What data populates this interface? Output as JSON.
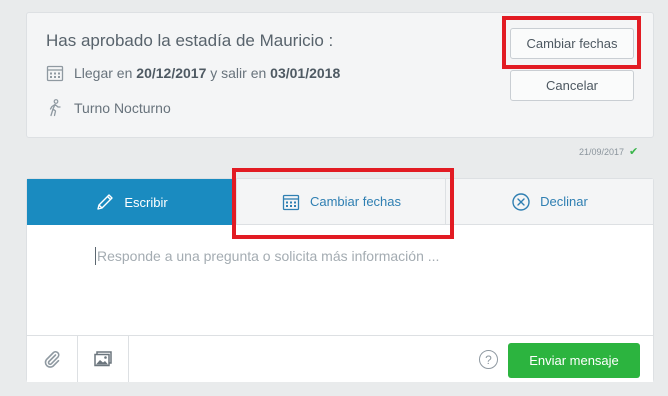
{
  "approval": {
    "title": "Has aprobado la estadía de Mauricio :",
    "arrive_label": "Llegar en",
    "arrive_date": "20/12/2017",
    "leave_label": "y salir en",
    "leave_date": "03/01/2018",
    "shift": "Turno Nocturno",
    "change_dates_button": "Cambiar fechas",
    "cancel_button": "Cancelar",
    "timestamp": "21/09/2017"
  },
  "composer": {
    "tabs": [
      {
        "label": "Escribir",
        "icon": "pencil-icon",
        "active": true
      },
      {
        "label": "Cambiar fechas",
        "icon": "calendar-icon",
        "active": false
      },
      {
        "label": "Declinar",
        "icon": "circle-x-icon",
        "active": false
      }
    ],
    "placeholder": "Responde a una pregunta o solicita más información ...",
    "help_label": "?",
    "send_button": "Enviar mensaje"
  },
  "colors": {
    "accent": "#1a8bc0",
    "send": "#2cb43f",
    "highlight": "#e21b23",
    "check": "#39b54a"
  }
}
